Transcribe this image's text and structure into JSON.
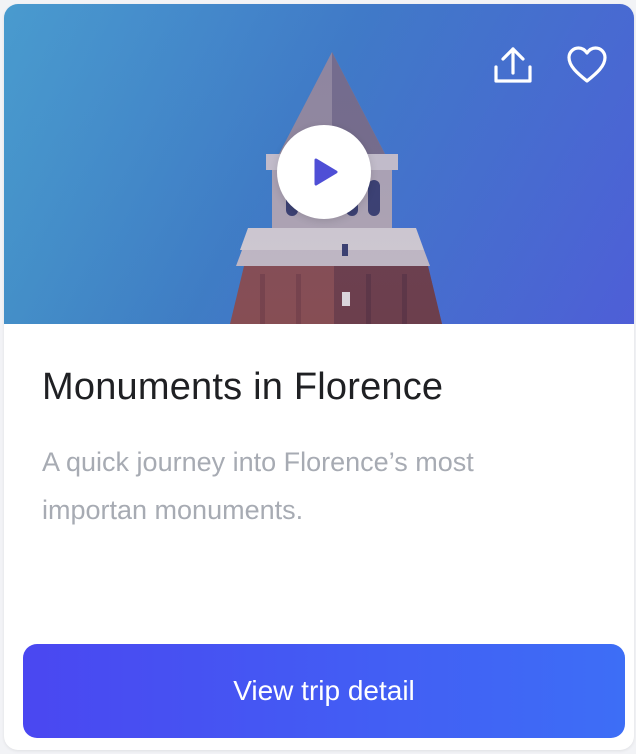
{
  "card": {
    "title": "Monuments in Florence",
    "description": "A quick journey into Florence’s most importan monuments.",
    "cta_label": "View trip detail"
  },
  "icons": {
    "share": "share-upload-icon",
    "favorite": "heart-icon",
    "play": "play-icon"
  },
  "colors": {
    "cta_start": "#4a47f1",
    "cta_end": "#3d6ef6",
    "title": "#1f2023",
    "description": "#a7abb3"
  }
}
